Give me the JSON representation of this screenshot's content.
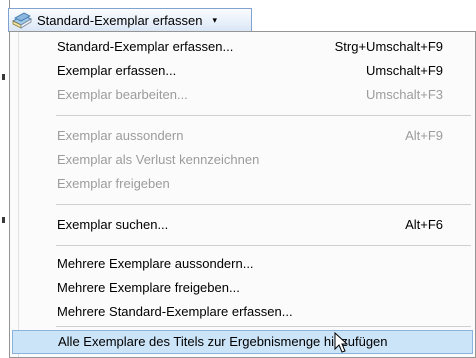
{
  "toolbar": {
    "label": "Standard-Exemplar erfassen",
    "dropdown_glyph": "▾",
    "icon": "books-icon"
  },
  "menu": {
    "items": [
      {
        "label": "Standard-Exemplar erfassen...",
        "shortcut": "Strg+Umschalt+F9",
        "enabled": true
      },
      {
        "label": "Exemplar erfassen...",
        "shortcut": "Umschalt+F9",
        "enabled": true
      },
      {
        "label": "Exemplar bearbeiten...",
        "shortcut": "Umschalt+F3",
        "enabled": false
      },
      {
        "label": "Exemplar aussondern",
        "shortcut": "Alt+F9",
        "enabled": false
      },
      {
        "label": "Exemplar als Verlust kennzeichnen",
        "shortcut": "",
        "enabled": false
      },
      {
        "label": "Exemplar freigeben",
        "shortcut": "",
        "enabled": false
      },
      {
        "label": "Exemplar suchen...",
        "shortcut": "Alt+F6",
        "enabled": true
      },
      {
        "label": "Mehrere Exemplare aussondern...",
        "shortcut": "",
        "enabled": true
      },
      {
        "label": "Mehrere Exemplare freigeben...",
        "shortcut": "",
        "enabled": true
      },
      {
        "label": "Mehrere Standard-Exemplare erfassen...",
        "shortcut": "",
        "enabled": true
      },
      {
        "label": "Alle Exemplare des Titels zur Ergebnismenge hinzufügen",
        "shortcut": "",
        "enabled": true,
        "highlighted": true
      }
    ]
  },
  "colors": {
    "highlight": "#cce4f7",
    "highlight_border": "#87b3de",
    "disabled_text": "#9c9c9c",
    "toolbar_border": "#7fa2cf"
  }
}
